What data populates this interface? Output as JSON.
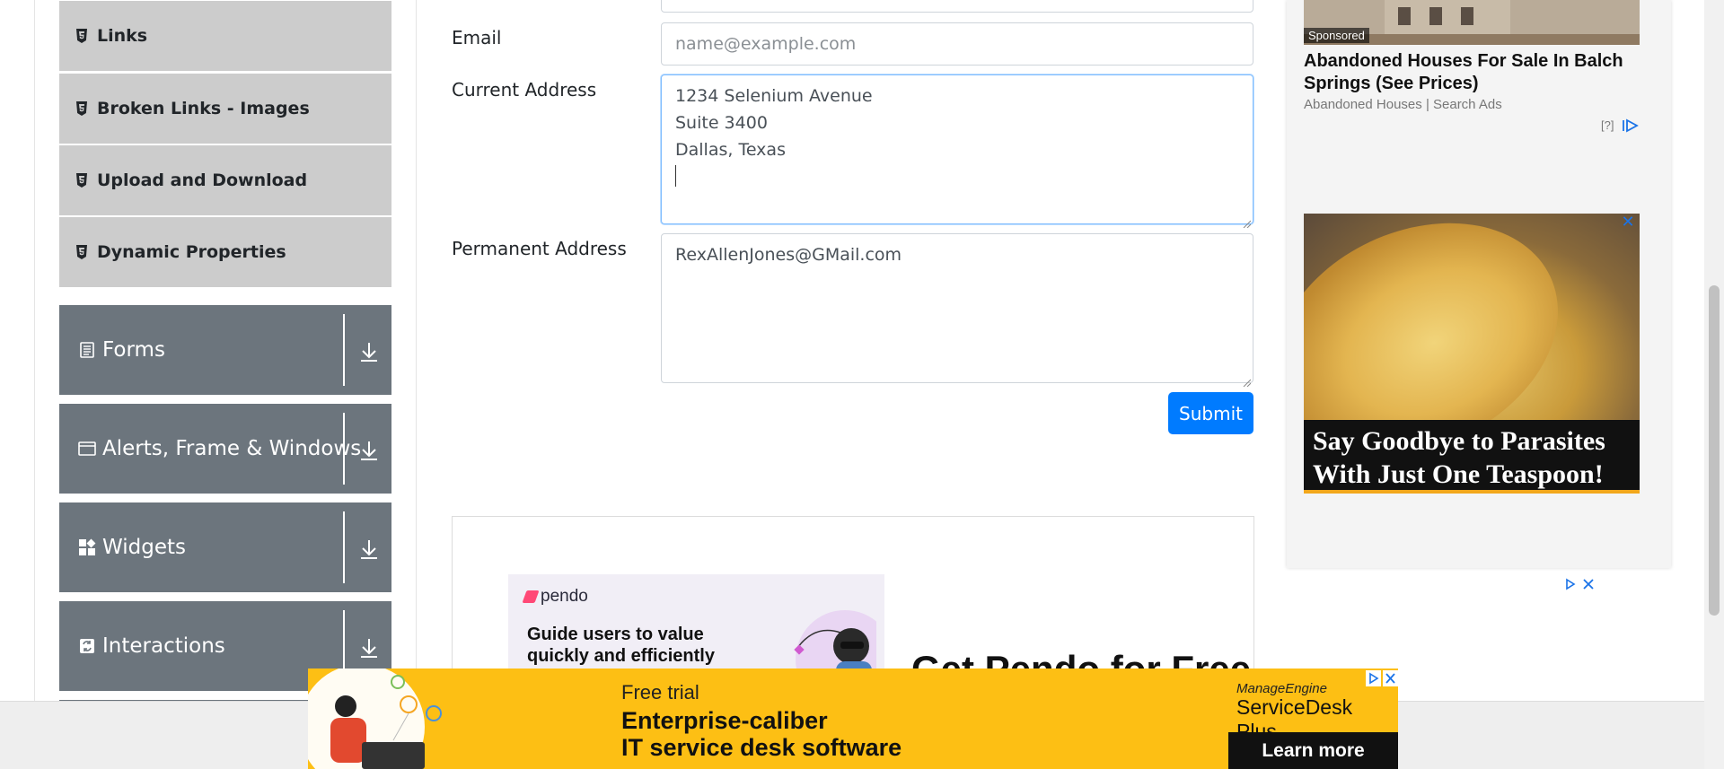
{
  "sidebar": {
    "items": [
      {
        "label": "Links",
        "icon": "html5-icon"
      },
      {
        "label": "Broken Links - Images",
        "icon": "html5-icon"
      },
      {
        "label": "Upload and Download",
        "icon": "html5-icon"
      },
      {
        "label": "Dynamic Properties",
        "icon": "html5-icon"
      }
    ],
    "groups": [
      {
        "label": "Forms",
        "icon": "document-icon"
      },
      {
        "label": "Alerts, Frame & Windows",
        "icon": "window-icon"
      },
      {
        "label": "Widgets",
        "icon": "widgets-icon"
      },
      {
        "label": "Interactions",
        "icon": "interactions-icon"
      }
    ]
  },
  "form": {
    "email_label": "Email",
    "email_placeholder": "name@example.com",
    "current_address_label": "Current Address",
    "current_address_lines": [
      "1234 Selenium Avenue",
      "Suite 3400",
      "Dallas, Texas"
    ],
    "permanent_address_label": "Permanent Address",
    "permanent_address_value": "RexAllenJones@GMail.com",
    "submit_label": "Submit"
  },
  "ads": {
    "native": {
      "tag": "Sponsored",
      "title": "Abandoned Houses For Sale In Balch Springs (See Prices)",
      "source": "Abandoned Houses | Search Ads",
      "help": "[?]"
    },
    "food": {
      "caption": "Say Goodbye to Parasites With Just One Teaspoon!",
      "close": "✕"
    },
    "pendo": {
      "brand": "pendo",
      "headline": "Guide users to value quickly and efficiently",
      "big_text": "Get Pendo for Free"
    },
    "banner": {
      "free": "Free trial",
      "headline_line1": "Enterprise-caliber",
      "headline_line2": "IT service desk software",
      "brand_top": "ManageEngine",
      "brand": "ServiceDesk Plus",
      "cta": "Learn more"
    }
  },
  "colors": {
    "accent": "#007bff",
    "menu_item_bg": "#cccccc",
    "group_bg": "#6c757d",
    "banner_bg": "#fdbf14"
  }
}
